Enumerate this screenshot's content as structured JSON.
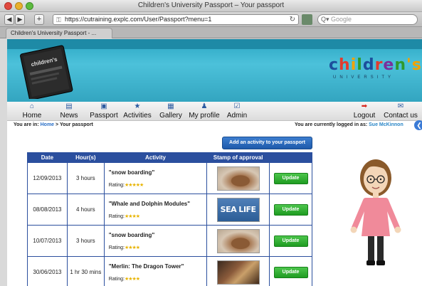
{
  "window": {
    "title": "Children's University Passport – Your passport",
    "url": "https://cutraining.explc.com/User/Passport?menu=1",
    "search_placeholder": "Google",
    "tab_label": "Children's University Passport - ..."
  },
  "header": {
    "passport_label": "children's",
    "logo_text": "children's",
    "logo_sub": "UNIVERSITY"
  },
  "nav": {
    "items": [
      {
        "label": "Home",
        "icon": "home-icon"
      },
      {
        "label": "News",
        "icon": "news-icon"
      },
      {
        "label": "Passport",
        "icon": "passport-icon"
      },
      {
        "label": "Activities",
        "icon": "star-icon"
      },
      {
        "label": "Gallery",
        "icon": "gallery-icon"
      },
      {
        "label": "My profile",
        "icon": "person-icon"
      },
      {
        "label": "Admin",
        "icon": "checkbox-icon"
      },
      {
        "label": "Logout",
        "icon": "arrow-icon"
      },
      {
        "label": "Contact us",
        "icon": "envelope-icon"
      }
    ]
  },
  "breadcrumb": {
    "prefix": "You are in:",
    "home": "Home",
    "sep": ">",
    "current": "Your passport"
  },
  "session": {
    "prefix": "You are currently logged in as:",
    "user": "Sue McKinnon"
  },
  "add_button": "Add an activity to your passport",
  "table": {
    "headers": [
      "Date",
      "Hour(s)",
      "Activity",
      "Stamp of approval",
      ""
    ],
    "rating_label": "Rating:",
    "update_label": "Update",
    "rows": [
      {
        "date": "12/09/2013",
        "hours": "3 hours",
        "activity": "\"snow boarding\"",
        "stars": "★★★★★",
        "rating": 5,
        "stamp": "beaver"
      },
      {
        "date": "08/08/2013",
        "hours": "4 hours",
        "activity": "\"Whale and Dolphin Modules\"",
        "stars": "★★★★",
        "rating": 4,
        "stamp": "sealife",
        "stamp_text": "SEA LIFE"
      },
      {
        "date": "10/07/2013",
        "hours": "3 hours",
        "activity": "\"snow boarding\"",
        "stars": "★★★★",
        "rating": 4,
        "stamp": "beaver"
      },
      {
        "date": "30/06/2013",
        "hours": "1 hr 30 mins",
        "activity": "\"Merlin: The Dragon Tower\"",
        "stars": "★★★★",
        "rating": 4,
        "stamp": "merlin"
      }
    ]
  },
  "colors": {
    "header_blue": "#2aa6c3",
    "table_header": "#2b4f9e",
    "update_green": "#1f9c21",
    "link_blue": "#2a6fc7"
  }
}
